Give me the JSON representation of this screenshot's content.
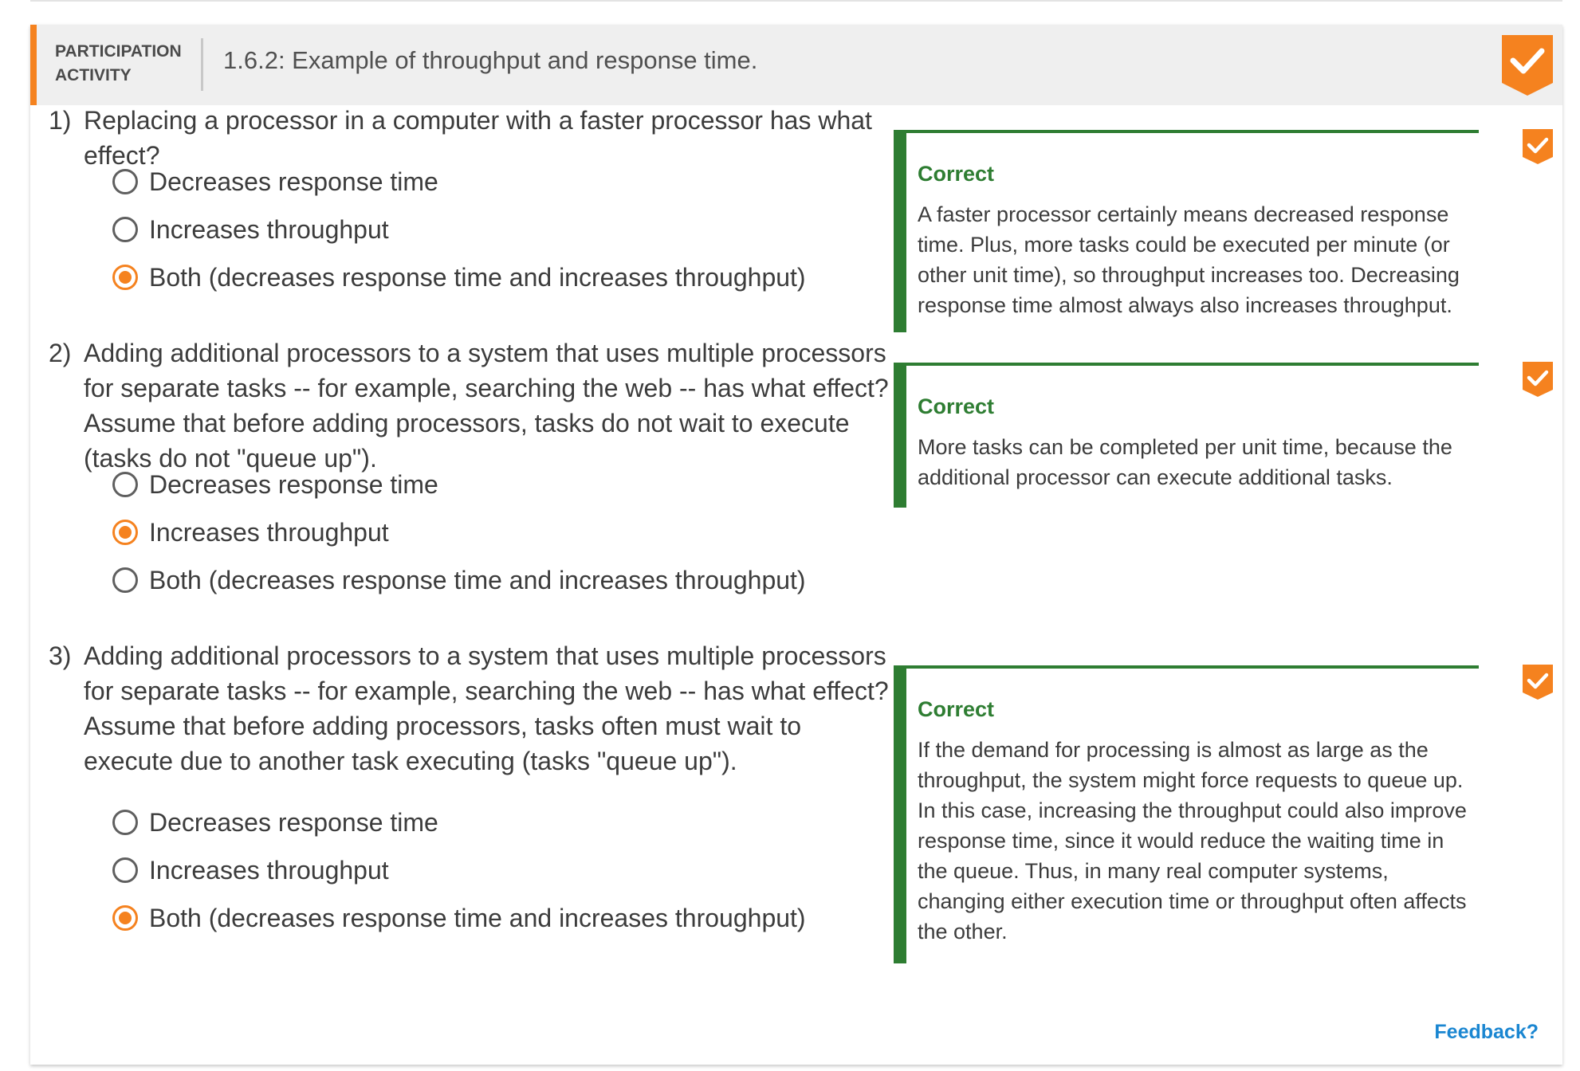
{
  "header": {
    "type_line1": "PARTICIPATION",
    "type_line2": "ACTIVITY",
    "title": "1.6.2: Example of throughput and response time."
  },
  "questions": [
    {
      "number": "1)",
      "text": "Replacing a processor in a computer with a faster processor has what effect?",
      "choices": [
        {
          "label": "Decreases response time",
          "selected": false
        },
        {
          "label": "Increases throughput",
          "selected": false
        },
        {
          "label": "Both (decreases response time and increases throughput)",
          "selected": true
        }
      ],
      "feedback": {
        "heading": "Correct",
        "body": "A faster processor certainly means decreased response time. Plus, more tasks could be executed per minute (or other unit time), so throughput increases too. Decreasing response time almost always also increases throughput."
      }
    },
    {
      "number": "2)",
      "text": "Adding additional processors to a system that uses multiple processors for separate tasks -- for example, searching the web -- has what effect? Assume that before adding processors, tasks do not wait to execute (tasks do not \"queue up\").",
      "choices": [
        {
          "label": "Decreases response time",
          "selected": false
        },
        {
          "label": "Increases throughput",
          "selected": true
        },
        {
          "label": "Both (decreases response time and increases throughput)",
          "selected": false
        }
      ],
      "feedback": {
        "heading": "Correct",
        "body": "More tasks can be completed per unit time, because the additional processor can execute additional tasks."
      }
    },
    {
      "number": "3)",
      "text": "Adding additional processors to a system that uses multiple processors for separate tasks -- for example, searching the web -- has what effect? Assume that before adding processors, tasks often must wait to execute due to another task executing (tasks \"queue up\").",
      "choices": [
        {
          "label": "Decreases response time",
          "selected": false
        },
        {
          "label": "Increases throughput",
          "selected": false
        },
        {
          "label": "Both (decreases response time and increases throughput)",
          "selected": true
        }
      ],
      "feedback": {
        "heading": "Correct",
        "body": "If the demand for processing is almost as large as the throughput, the system might force requests to queue up. In this case, increasing the throughput could also improve response time, since it would reduce the waiting time in the queue. Thus, in many real computer systems, changing either execution time or throughput often affects the other."
      }
    }
  ],
  "footer": {
    "feedback_link": "Feedback?"
  },
  "colors": {
    "accent": "#f5821f",
    "correct": "#2e7d32",
    "link": "#1a86d1"
  },
  "icons": {
    "header_status": "check-badge-icon",
    "question_status": "check-badge-icon",
    "choice": "radio-icon"
  }
}
